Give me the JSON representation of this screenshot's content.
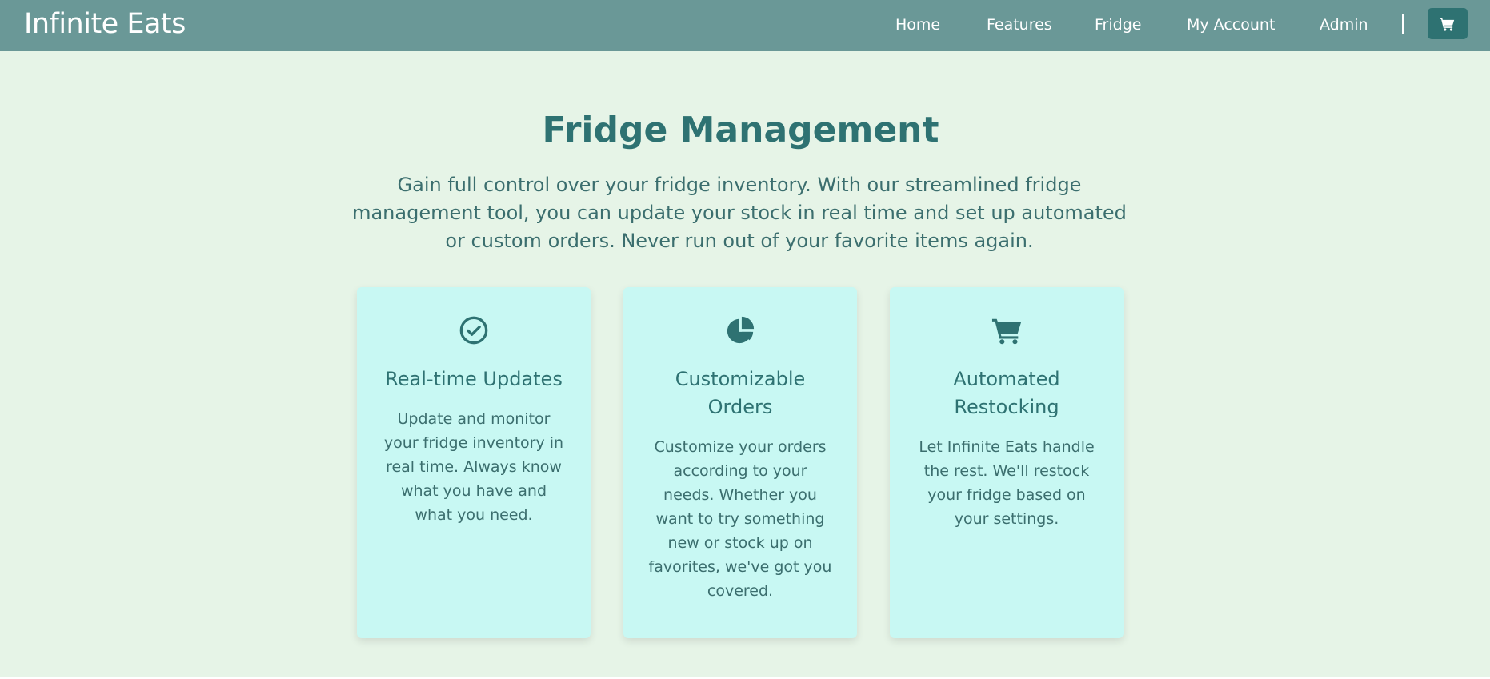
{
  "header": {
    "brand": "Infinite Eats",
    "nav": [
      "Home",
      "Features",
      "Fridge",
      "My Account",
      "Admin"
    ]
  },
  "cart": {
    "icon": "shopping-cart-icon"
  },
  "main": {
    "title": "Fridge Management",
    "intro": "Gain full control over your fridge inventory. With our streamlined fridge management tool, you can update your stock in real time and set up automated or custom orders. Never run out of your favorite items again.",
    "features": [
      {
        "icon": "check-circle-icon",
        "title": "Real-time Updates",
        "text": "Update and monitor your fridge inventory in real time. Always know what you have and what you need."
      },
      {
        "icon": "pie-chart-icon",
        "title": "Customizable Orders",
        "text": "Customize your orders according to your needs. Whether you want to try something new or stock up on favorites, we've got you covered."
      },
      {
        "icon": "shopping-cart-icon",
        "title": "Automated Restocking",
        "text": "Let Infinite Eats handle the rest. We'll restock your fridge based on your settings."
      }
    ]
  },
  "colors": {
    "navbar": "#6a9897",
    "accent": "#2e7272",
    "background": "#e6f4e7",
    "card": "#c8f8f3"
  }
}
